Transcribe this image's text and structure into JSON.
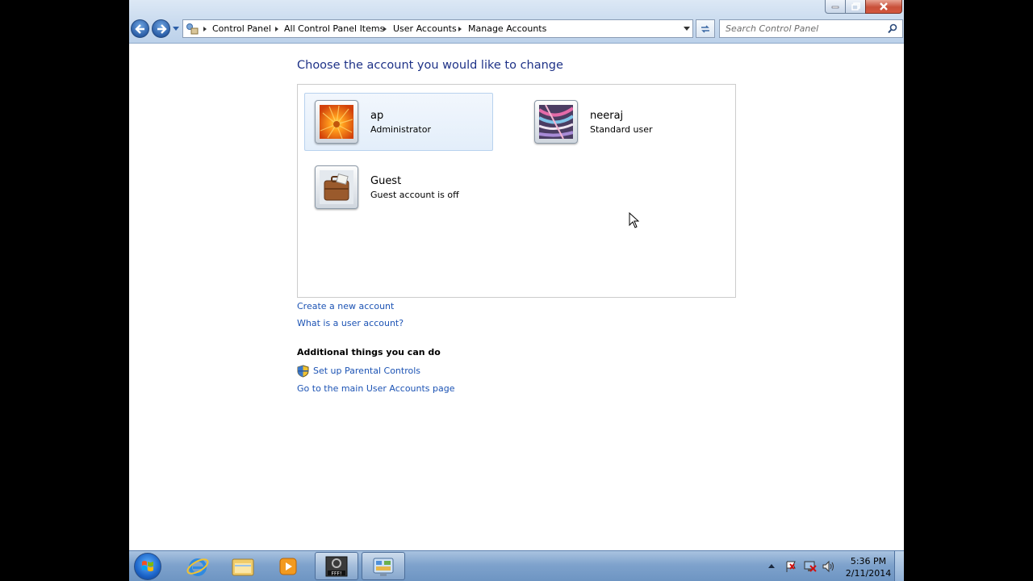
{
  "window": {
    "breadcrumbs": [
      "Control Panel",
      "All Control Panel Items",
      "User Accounts",
      "Manage Accounts"
    ],
    "search_placeholder": "Search Control Panel"
  },
  "main": {
    "title": "Choose the account you would like to change",
    "accounts": [
      {
        "name": "ap",
        "type": "Administrator",
        "selected": true
      },
      {
        "name": "neeraj",
        "type": "Standard user",
        "selected": false
      },
      {
        "name": "Guest",
        "type": "Guest account is off",
        "selected": false
      }
    ],
    "links": {
      "create_account": "Create a new account",
      "what_is_account": "What is a user account?"
    },
    "additional": {
      "heading": "Additional things you can do",
      "parental_controls": "Set up Parental Controls",
      "main_page": "Go to the main User Accounts page"
    }
  },
  "taskbar": {
    "time": "5:36 PM",
    "date": "2/11/2014",
    "apps": [
      "internet-explorer",
      "windows-explorer",
      "media-player",
      "fff-app",
      "control-panel"
    ]
  },
  "colors": {
    "title": "#1e3287",
    "link": "#1c53b4",
    "selection": "#e3eefa"
  }
}
